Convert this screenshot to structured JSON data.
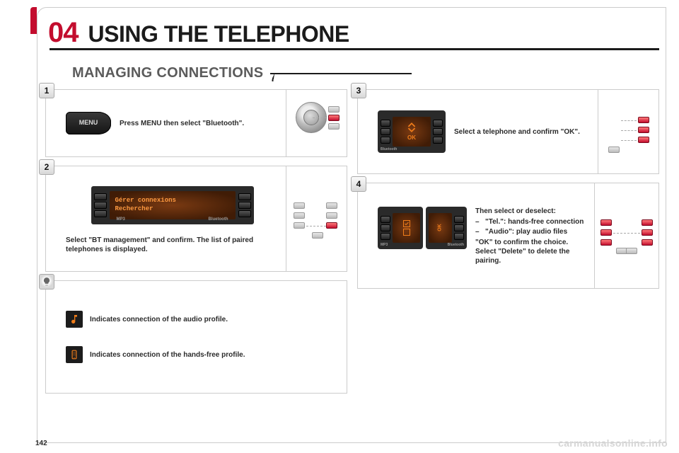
{
  "page_number": "142",
  "watermark": "carmanualsonline.info",
  "chapter": {
    "num": "04",
    "title": "USING THE TELEPHONE"
  },
  "subtitle": "MANAGING CONNECTIONS",
  "menu_button_label": "MENU",
  "steps": {
    "s1": {
      "badge": "1",
      "text": "Press MENU then select \"Bluetooth\"."
    },
    "s2": {
      "badge": "2",
      "screen_line1": "Gérer connexions",
      "screen_line2": "Rechercher",
      "foot_left": "MP3",
      "foot_right": "Bluetooth",
      "text": "Select \"BT management\" and confirm. The list of paired telephones is displayed."
    },
    "hint": {
      "line1": "Indicates connection of the audio profile.",
      "line2": "Indicates connection of the hands-free profile."
    },
    "s3": {
      "badge": "3",
      "text": "Select a telephone and confirm \"OK\".",
      "screen_ok": "OK",
      "screen_foot": "Bluetooth"
    },
    "s4": {
      "badge": "4",
      "heading": "Then select or deselect:",
      "opt1": "\"Tel.\": hands-free connection",
      "opt2": "\"Audio\": play audio files",
      "line2": "\"OK\" to confirm the choice.",
      "line3": "Select \"Delete\" to delete the pairing.",
      "foot_left": "MP3",
      "foot_right": "Bluetooth",
      "screen_ok": "OK"
    }
  }
}
